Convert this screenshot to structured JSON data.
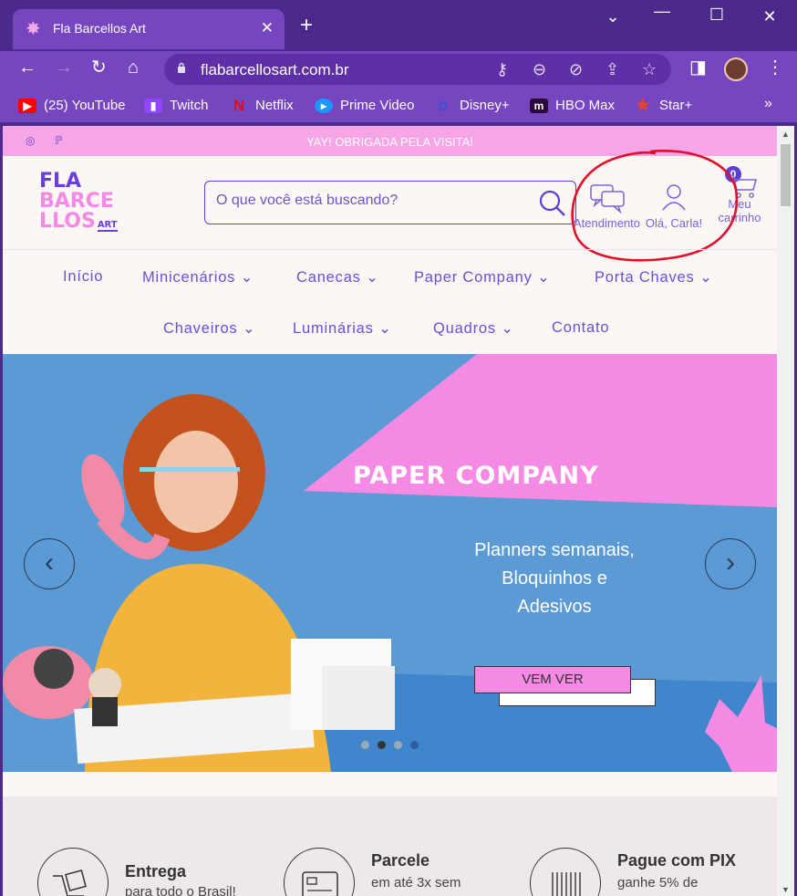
{
  "browser": {
    "tab_title": "Fla Barcellos Art",
    "url": "flabarcellosart.com.br",
    "bookmarks": [
      {
        "label": "(25) YouTube",
        "icon": "youtube-icon",
        "color": "#ff0000"
      },
      {
        "label": "Twitch",
        "icon": "twitch-icon",
        "color": "#9146ff"
      },
      {
        "label": "Netflix",
        "icon": "netflix-icon",
        "color": "#e50914"
      },
      {
        "label": "Prime Video",
        "icon": "prime-video-icon",
        "color": "#1a98ff"
      },
      {
        "label": "Disney+",
        "icon": "disney-plus-icon",
        "color": "#1432b5"
      },
      {
        "label": "HBO Max",
        "icon": "hbo-max-icon",
        "color": "#5b1c8b"
      },
      {
        "label": "Star+",
        "icon": "star-plus-icon",
        "color": "#e8442c"
      }
    ],
    "more_bookmarks": "»"
  },
  "site": {
    "announcement": "YAY! OBRIGADA PELA VISITA!",
    "logo": {
      "line1": "FLA",
      "line2": "BARCE",
      "line3": "LLOS",
      "art": "ART"
    },
    "search_placeholder": "O que você está buscando?",
    "actions": {
      "support": "Atendimento",
      "account": "Olá, Carla!",
      "cart_line1": "Meu",
      "cart_line2": "carrinho",
      "cart_count": "0"
    },
    "categories_row1": [
      "Início",
      "Minicenários",
      "Canecas",
      "Paper Company",
      "Porta Chaves"
    ],
    "categories_row2": [
      "Chaveiros",
      "Luminárias",
      "Quadros",
      "Contato"
    ],
    "hero": {
      "headline": "PAPER COMPANY",
      "sub1": "Planners semanais,",
      "sub2": "Bloquinhos e",
      "sub3": "Adesivos",
      "cta": "VEM VER"
    },
    "features": [
      {
        "title": "Entrega",
        "desc": "para todo o Brasil!"
      },
      {
        "title": "Parcele",
        "desc": "em até 3x sem"
      },
      {
        "title": "Pague com PIX",
        "desc": "ganhe 5% de"
      }
    ],
    "colors": {
      "accent": "#6a3ee0",
      "pink": "#f48ae4",
      "annotation": "#e0102a"
    }
  }
}
